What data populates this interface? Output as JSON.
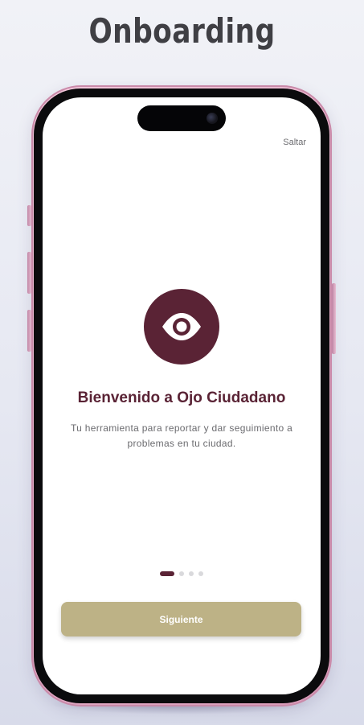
{
  "page": {
    "heading": "Onboarding"
  },
  "onboarding": {
    "skip_label": "Saltar",
    "logo_icon": "eye-icon",
    "title": "Bienvenido a Ojo Ciudadano",
    "subtitle": "Tu herramienta para reportar y dar seguimiento a problemas en tu ciudad.",
    "pages_total": 4,
    "page_current": 1,
    "next_label": "Siguiente"
  },
  "colors": {
    "brand": "#5a2335",
    "button": "#bdb286",
    "phone_frame": "#e8b3cc",
    "background": "#e6e8f2"
  }
}
